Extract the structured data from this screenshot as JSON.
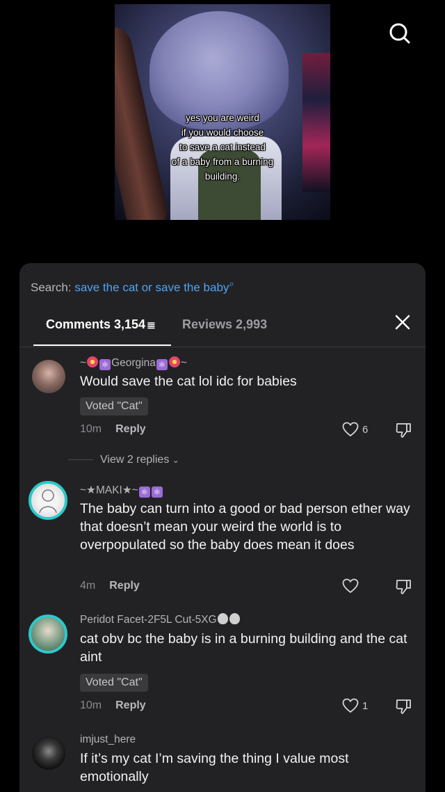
{
  "video": {
    "caption_lines": [
      "yes you are weird",
      "if you would choose",
      "to save a cat instead",
      "of a baby from a burning",
      "building."
    ]
  },
  "top_icons": {
    "search": "search-icon"
  },
  "sheet": {
    "search_prefix": "Search:",
    "search_term": "save the cat or save the baby",
    "tabs": [
      {
        "label": "Comments 3,154",
        "active": true
      },
      {
        "label": "Reviews 2,993",
        "active": false
      }
    ]
  },
  "comments": [
    {
      "username": "Georgina",
      "text": "Would save the cat lol idc for babies",
      "vote": "Voted \"Cat\"",
      "time": "10m",
      "reply_label": "Reply",
      "likes": "6",
      "view_replies": "View 2 replies"
    },
    {
      "username": "MAKI",
      "text": "The baby can turn into a good or bad person ether way that doesn’t mean your weird the world is to overpopulated so the baby does mean it does",
      "time": "4m",
      "reply_label": "Reply",
      "likes": ""
    },
    {
      "username": "Peridot Facet-2F5L Cut-5XG",
      "text": "cat obv bc the baby is in a burning building and the cat aint",
      "vote": "Voted \"Cat\"",
      "time": "10m",
      "reply_label": "Reply",
      "likes": "1"
    },
    {
      "username": "imjust_here",
      "text": "If it’s my cat I’m saving the thing I value most emotionally"
    }
  ],
  "colors": {
    "accent_blue": "#4fa3f2",
    "sheet_bg": "#222224"
  }
}
